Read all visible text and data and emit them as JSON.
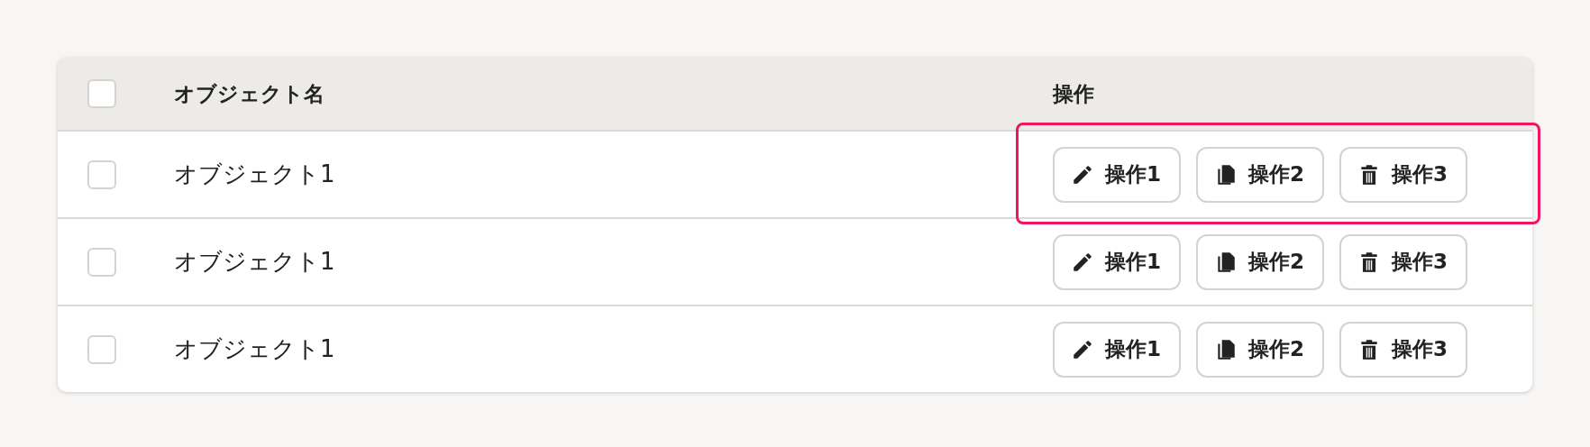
{
  "table": {
    "header": {
      "select_all": {
        "checked": false
      },
      "columns": [
        "オブジェクト名",
        "操作"
      ]
    },
    "rows": [
      {
        "checked": false,
        "name": "オブジェクト1",
        "highlighted": true,
        "actions": [
          {
            "kind": "edit",
            "label": "操作1"
          },
          {
            "kind": "copy",
            "label": "操作2"
          },
          {
            "kind": "delete",
            "label": "操作3"
          }
        ]
      },
      {
        "checked": false,
        "name": "オブジェクト1",
        "highlighted": false,
        "actions": [
          {
            "kind": "edit",
            "label": "操作1"
          },
          {
            "kind": "copy",
            "label": "操作2"
          },
          {
            "kind": "delete",
            "label": "操作3"
          }
        ]
      },
      {
        "checked": false,
        "name": "オブジェクト1",
        "highlighted": false,
        "actions": [
          {
            "kind": "edit",
            "label": "操作1"
          },
          {
            "kind": "copy",
            "label": "操作2"
          },
          {
            "kind": "delete",
            "label": "操作3"
          }
        ]
      }
    ]
  }
}
